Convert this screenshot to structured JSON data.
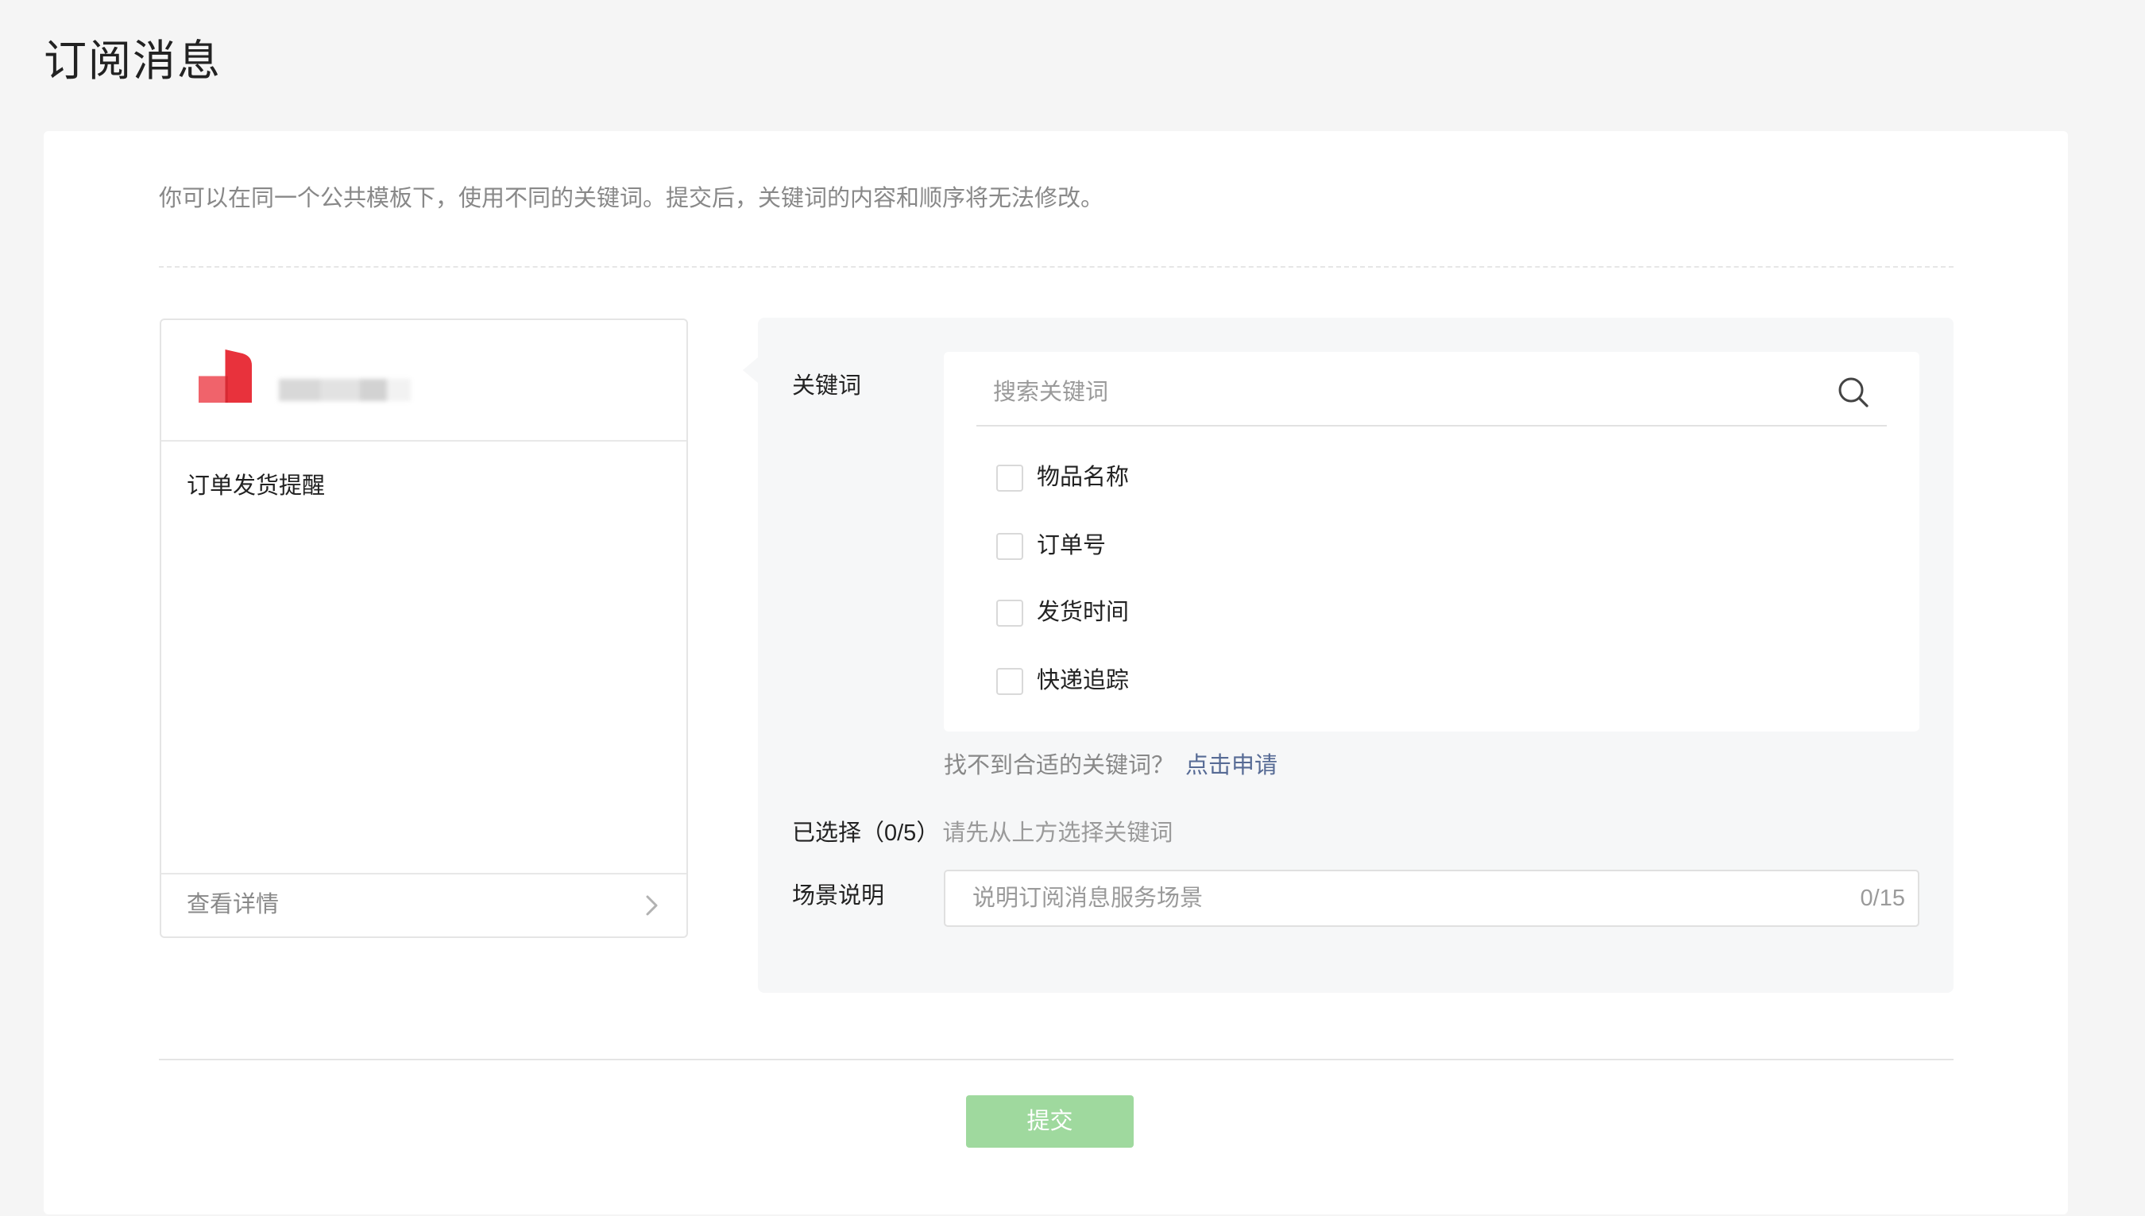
{
  "page": {
    "title": "订阅消息"
  },
  "notice": "你可以在同一个公共模板下，使用不同的关键词。提交后，关键词的内容和顺序将无法修改。",
  "preview": {
    "template_title": "订单发货提醒",
    "detail_link": "查看详情"
  },
  "form": {
    "keywords_label": "关键词",
    "search_placeholder": "搜索关键词",
    "keywords": [
      {
        "label": "物品名称",
        "checked": false
      },
      {
        "label": "订单号",
        "checked": false
      },
      {
        "label": "发货时间",
        "checked": false
      },
      {
        "label": "快递追踪",
        "checked": false
      }
    ],
    "not_found_text": "找不到合适的关键词？",
    "apply_link": "点击申请",
    "selected_label": "已选择（0/5）",
    "selected_hint": "请先从上方选择关键词",
    "scene_label": "场景说明",
    "scene_placeholder": "说明订阅消息服务场景",
    "scene_value": "",
    "scene_counter": "0/15"
  },
  "submit": {
    "label": "提交",
    "disabled": true
  },
  "icons": {
    "logo": "brand-logo-icon",
    "search": "search-icon",
    "chevron": "chevron-right-icon"
  },
  "colors": {
    "page_background": "#f5f5f5",
    "panel_background": "#f6f7f8",
    "link": "#576b95",
    "submit_disabled": "#9fd99e",
    "logo_primary": "#e8323c",
    "logo_secondary": "#f0636b"
  }
}
